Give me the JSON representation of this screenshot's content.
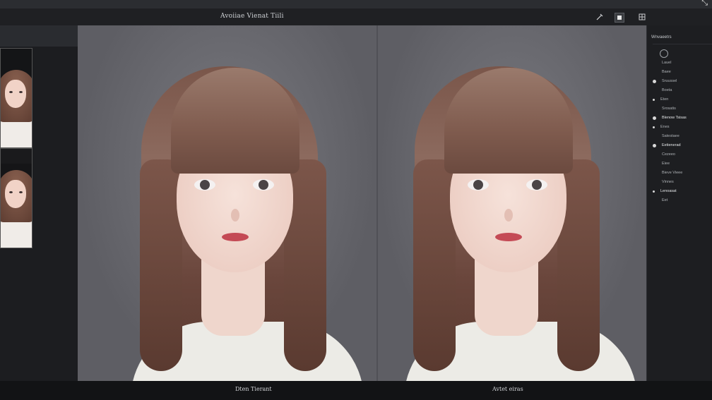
{
  "toolbar": {
    "title": "Avoiiae Vienat Tiili",
    "icons": [
      "wand-icon",
      "square-icon",
      "grid-icon"
    ]
  },
  "window_controls": {
    "resize_glyph": "⤡"
  },
  "left_strip": {
    "thumbnails": [
      {
        "name": "thumbnail-1"
      },
      {
        "name": "thumbnail-2"
      }
    ]
  },
  "canvas": {
    "left_label": "Dten Tierant",
    "right_label": "Avtet eiras"
  },
  "right_panel": {
    "header": "Wnvaeetrs",
    "items": [
      {
        "label": "Lauel",
        "dot": "none",
        "bold": false
      },
      {
        "label": "Baee",
        "dot": "none",
        "bold": false
      },
      {
        "label": "Sruussel",
        "dot": "big",
        "bold": false
      },
      {
        "label": "Boeta",
        "dot": "none",
        "bold": false
      },
      {
        "label": "Eten",
        "dot": "small",
        "bold": false
      },
      {
        "label": "Srosatis",
        "dot": "none",
        "bold": false
      },
      {
        "label": "Blenow Tsisas",
        "dot": "big",
        "bold": true
      },
      {
        "label": "Enes",
        "dot": "small",
        "bold": false
      },
      {
        "label": "Satestaee",
        "dot": "none",
        "bold": false
      },
      {
        "label": "Eetienerad",
        "dot": "big",
        "bold": true
      },
      {
        "label": "Cezeeo",
        "dot": "none",
        "bold": false
      },
      {
        "label": "Eiee",
        "dot": "none",
        "bold": false
      },
      {
        "label": "Bieve Vieee",
        "dot": "none",
        "bold": false
      },
      {
        "label": "Vinnes",
        "dot": "none",
        "bold": false
      },
      {
        "label": "Lenoasat",
        "dot": "small",
        "bold": true
      },
      {
        "label": "Eet",
        "dot": "none",
        "bold": false
      }
    ]
  }
}
